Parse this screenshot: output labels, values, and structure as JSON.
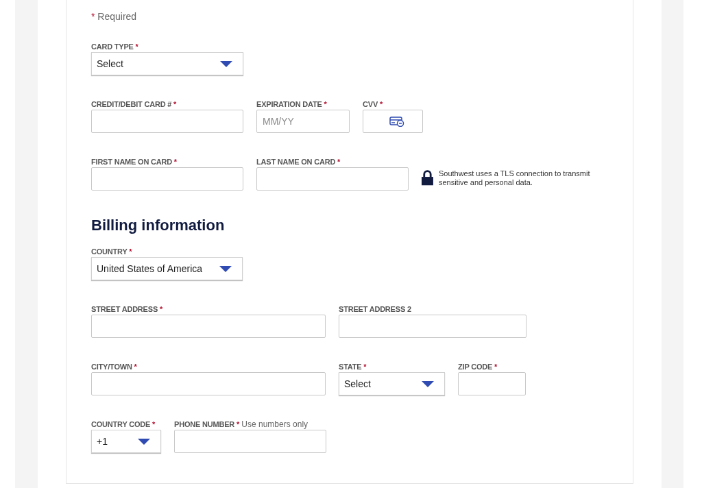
{
  "required_note": {
    "mark": "*",
    "text": "Required"
  },
  "payment_rows": [
    [
      {
        "kind": "select",
        "label": "CARD TYPE",
        "required_mark": "*",
        "value": "Select"
      }
    ],
    [
      {
        "kind": "input",
        "label": "CREDIT/DEBIT CARD #",
        "required_mark": "*"
      },
      {
        "kind": "input",
        "label": "EXPIRATION DATE",
        "required_mark": "*",
        "placeholder": "MM/YY"
      },
      {
        "kind": "cvv",
        "label": "CVV",
        "required_mark": "*"
      }
    ],
    [
      {
        "kind": "input",
        "label": "FIRST NAME ON CARD",
        "required_mark": "*"
      },
      {
        "kind": "input",
        "label": "LAST NAME ON CARD",
        "required_mark": "*"
      },
      {
        "kind": "note",
        "text": "Southwest uses a TLS connection to transmit sensitive and personal data."
      }
    ]
  ],
  "billing_heading": "Billing information",
  "billing_rows": [
    [
      {
        "kind": "select",
        "label": "COUNTRY",
        "required_mark": "*",
        "value": "United States of America"
      }
    ],
    [
      {
        "kind": "input",
        "label": "STREET ADDRESS",
        "required_mark": "*"
      },
      {
        "kind": "input",
        "label": "STREET ADDRESS 2"
      }
    ],
    [
      {
        "kind": "input",
        "label": "CITY/TOWN",
        "required_mark": "*"
      },
      {
        "kind": "select",
        "label": "STATE",
        "required_mark": "*",
        "value": "Select"
      },
      {
        "kind": "input",
        "label": "ZIP CODE",
        "required_mark": "*"
      }
    ],
    [
      {
        "kind": "select",
        "label": "COUNTRY CODE",
        "required_mark": "*",
        "value": "+1"
      },
      {
        "kind": "input",
        "label": "PHONE NUMBER",
        "required_mark": "*",
        "hint": "Use numbers only"
      }
    ]
  ]
}
